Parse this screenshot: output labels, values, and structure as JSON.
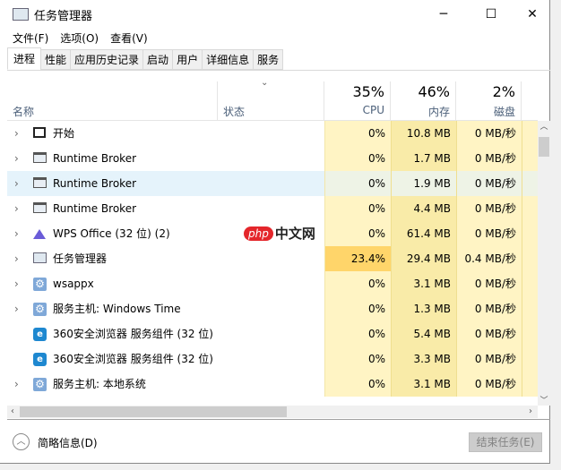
{
  "window": {
    "title": "任务管理器",
    "minimize": "─",
    "maximize": "☐",
    "close": "✕"
  },
  "menu": [
    "文件(F)",
    "选项(O)",
    "查看(V)"
  ],
  "tabs": [
    "进程",
    "性能",
    "应用历史记录",
    "启动",
    "用户",
    "详细信息",
    "服务"
  ],
  "columns": {
    "name": "名称",
    "status": "状态",
    "cpu_pct": "35%",
    "cpu": "CPU",
    "mem_pct": "46%",
    "mem": "内存",
    "disk_pct": "2%",
    "disk": "磁盘"
  },
  "rows": [
    {
      "name": "开始",
      "icon": "window-icon",
      "expand": true,
      "cpu": "0%",
      "mem": "10.8 MB",
      "disk": "0 MB/秒"
    },
    {
      "name": "Runtime Broker",
      "icon": "app-window-icon",
      "expand": true,
      "cpu": "0%",
      "mem": "1.7 MB",
      "disk": "0 MB/秒"
    },
    {
      "name": "Runtime Broker",
      "icon": "app-window-icon",
      "expand": true,
      "cpu": "0%",
      "mem": "1.9 MB",
      "disk": "0 MB/秒",
      "hover": true
    },
    {
      "name": "Runtime Broker",
      "icon": "app-window-icon",
      "expand": true,
      "cpu": "0%",
      "mem": "4.4 MB",
      "disk": "0 MB/秒"
    },
    {
      "name": "WPS Office (32 位) (2)",
      "icon": "wps-icon",
      "expand": true,
      "cpu": "0%",
      "mem": "61.4 MB",
      "disk": "0 MB/秒"
    },
    {
      "name": "任务管理器",
      "icon": "task-manager-icon",
      "expand": true,
      "cpu": "23.4%",
      "mem": "29.4 MB",
      "disk": "0.4 MB/秒",
      "hot": true
    },
    {
      "name": "wsappx",
      "icon": "gear-icon",
      "expand": true,
      "cpu": "0%",
      "mem": "3.1 MB",
      "disk": "0 MB/秒"
    },
    {
      "name": "服务主机: Windows Time",
      "icon": "gear-icon",
      "expand": true,
      "cpu": "0%",
      "mem": "1.3 MB",
      "disk": "0 MB/秒"
    },
    {
      "name": "360安全浏览器 服务组件 (32 位)",
      "icon": "browser-360-icon",
      "expand": false,
      "cpu": "0%",
      "mem": "5.4 MB",
      "disk": "0 MB/秒"
    },
    {
      "name": "360安全浏览器 服务组件 (32 位)",
      "icon": "browser-360-icon",
      "expand": false,
      "cpu": "0%",
      "mem": "3.3 MB",
      "disk": "0 MB/秒"
    },
    {
      "name": "服务主机: 本地系统",
      "icon": "gear-icon",
      "expand": true,
      "cpu": "0%",
      "mem": "3.1 MB",
      "disk": "0 MB/秒"
    }
  ],
  "footer": {
    "less_details": "简略信息(D)",
    "end_task": "结束任务(E)"
  },
  "watermark": {
    "php": "php",
    "cn": "中文网"
  },
  "colors": {
    "cpu_bg": "#fff4c4",
    "mem_bg": "#f9eba8",
    "hot": "#ffd56a",
    "hover": "#e5f3fb"
  }
}
